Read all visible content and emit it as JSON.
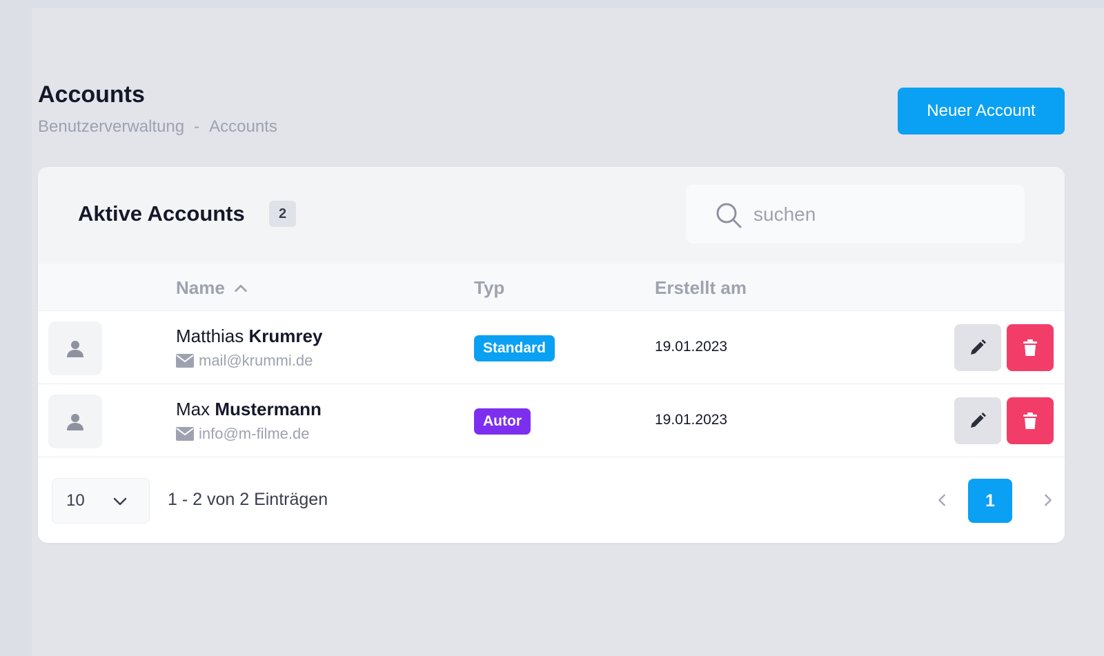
{
  "page": {
    "title": "Accounts",
    "breadcrumb": [
      "Benutzerverwaltung",
      "-",
      "Accounts"
    ],
    "new_button_label": "Neuer Account"
  },
  "card": {
    "title": "Aktive Accounts",
    "count": "2",
    "search_placeholder": "suchen"
  },
  "table": {
    "headers": {
      "name": "Name",
      "typ": "Typ",
      "created": "Erstellt am"
    },
    "rows": [
      {
        "first": "Matthias",
        "last": "Krumrey",
        "email": "mail@krummi.de",
        "type": "Standard",
        "type_color": "#0aa0f3",
        "created": "19.01.2023"
      },
      {
        "first": "Max",
        "last": "Mustermann",
        "email": "info@m-filme.de",
        "type": "Autor",
        "type_color": "#7d2ff0",
        "created": "19.01.2023"
      }
    ]
  },
  "footer": {
    "per_page": "10",
    "entries": "1 - 2 von 2 Einträgen",
    "current_page": "1"
  },
  "colors": {
    "accent": "#0aa0f3",
    "danger": "#f23d68",
    "autor": "#7d2ff0"
  },
  "icons": [
    "search-icon",
    "chevron-up-icon",
    "user-icon",
    "mail-icon",
    "pencil-icon",
    "trash-icon",
    "chevron-down-icon",
    "chevron-left-icon",
    "chevron-right-icon"
  ]
}
